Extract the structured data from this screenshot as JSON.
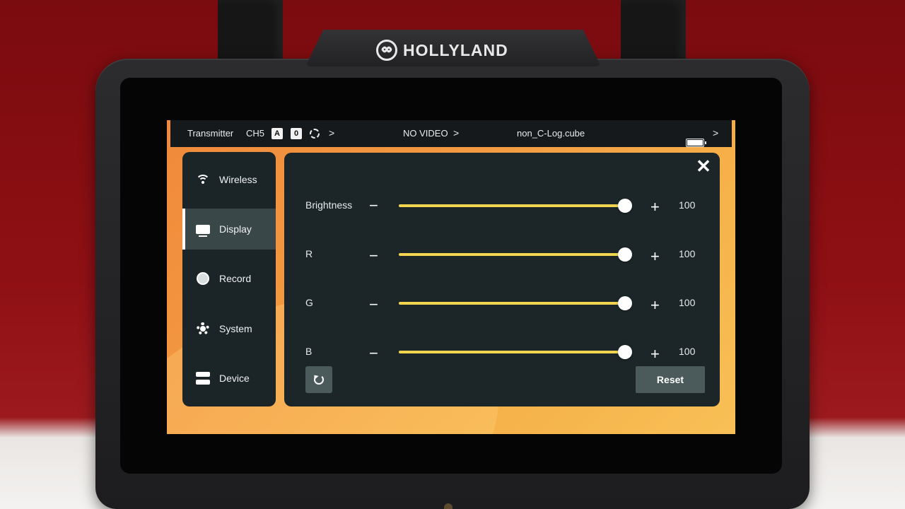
{
  "brand": {
    "name": "HOLLYLAND"
  },
  "statusbar": {
    "mode": "Transmitter",
    "channel": "CH5",
    "badge_a": "A",
    "badge_0": "0",
    "video_status": "NO VIDEO",
    "lut_file": "non_C-Log.cube",
    "chevron": ">"
  },
  "sidebar": {
    "items": [
      {
        "label": "Wireless",
        "icon": "wifi-icon"
      },
      {
        "label": "Display",
        "icon": "monitor-icon",
        "active": true
      },
      {
        "label": "Record",
        "icon": "record-icon"
      },
      {
        "label": "System",
        "icon": "gear-icon"
      },
      {
        "label": "Device",
        "icon": "device-icon"
      }
    ]
  },
  "panel": {
    "close": "✕",
    "minus": "−",
    "plus": "+",
    "rows": [
      {
        "label": "Brightness",
        "value": "100",
        "level": 1.0
      },
      {
        "label": "R",
        "value": "100",
        "level": 1.0
      },
      {
        "label": "G",
        "value": "100",
        "level": 1.0
      },
      {
        "label": "B",
        "value": "100",
        "level": 1.0
      }
    ],
    "reset_label": "Reset",
    "undo_icon": "undo-icon"
  },
  "colors": {
    "accent_slider": "#f2d54e",
    "panel_bg": "#1c2629",
    "wallpaper": "#f39b42"
  }
}
